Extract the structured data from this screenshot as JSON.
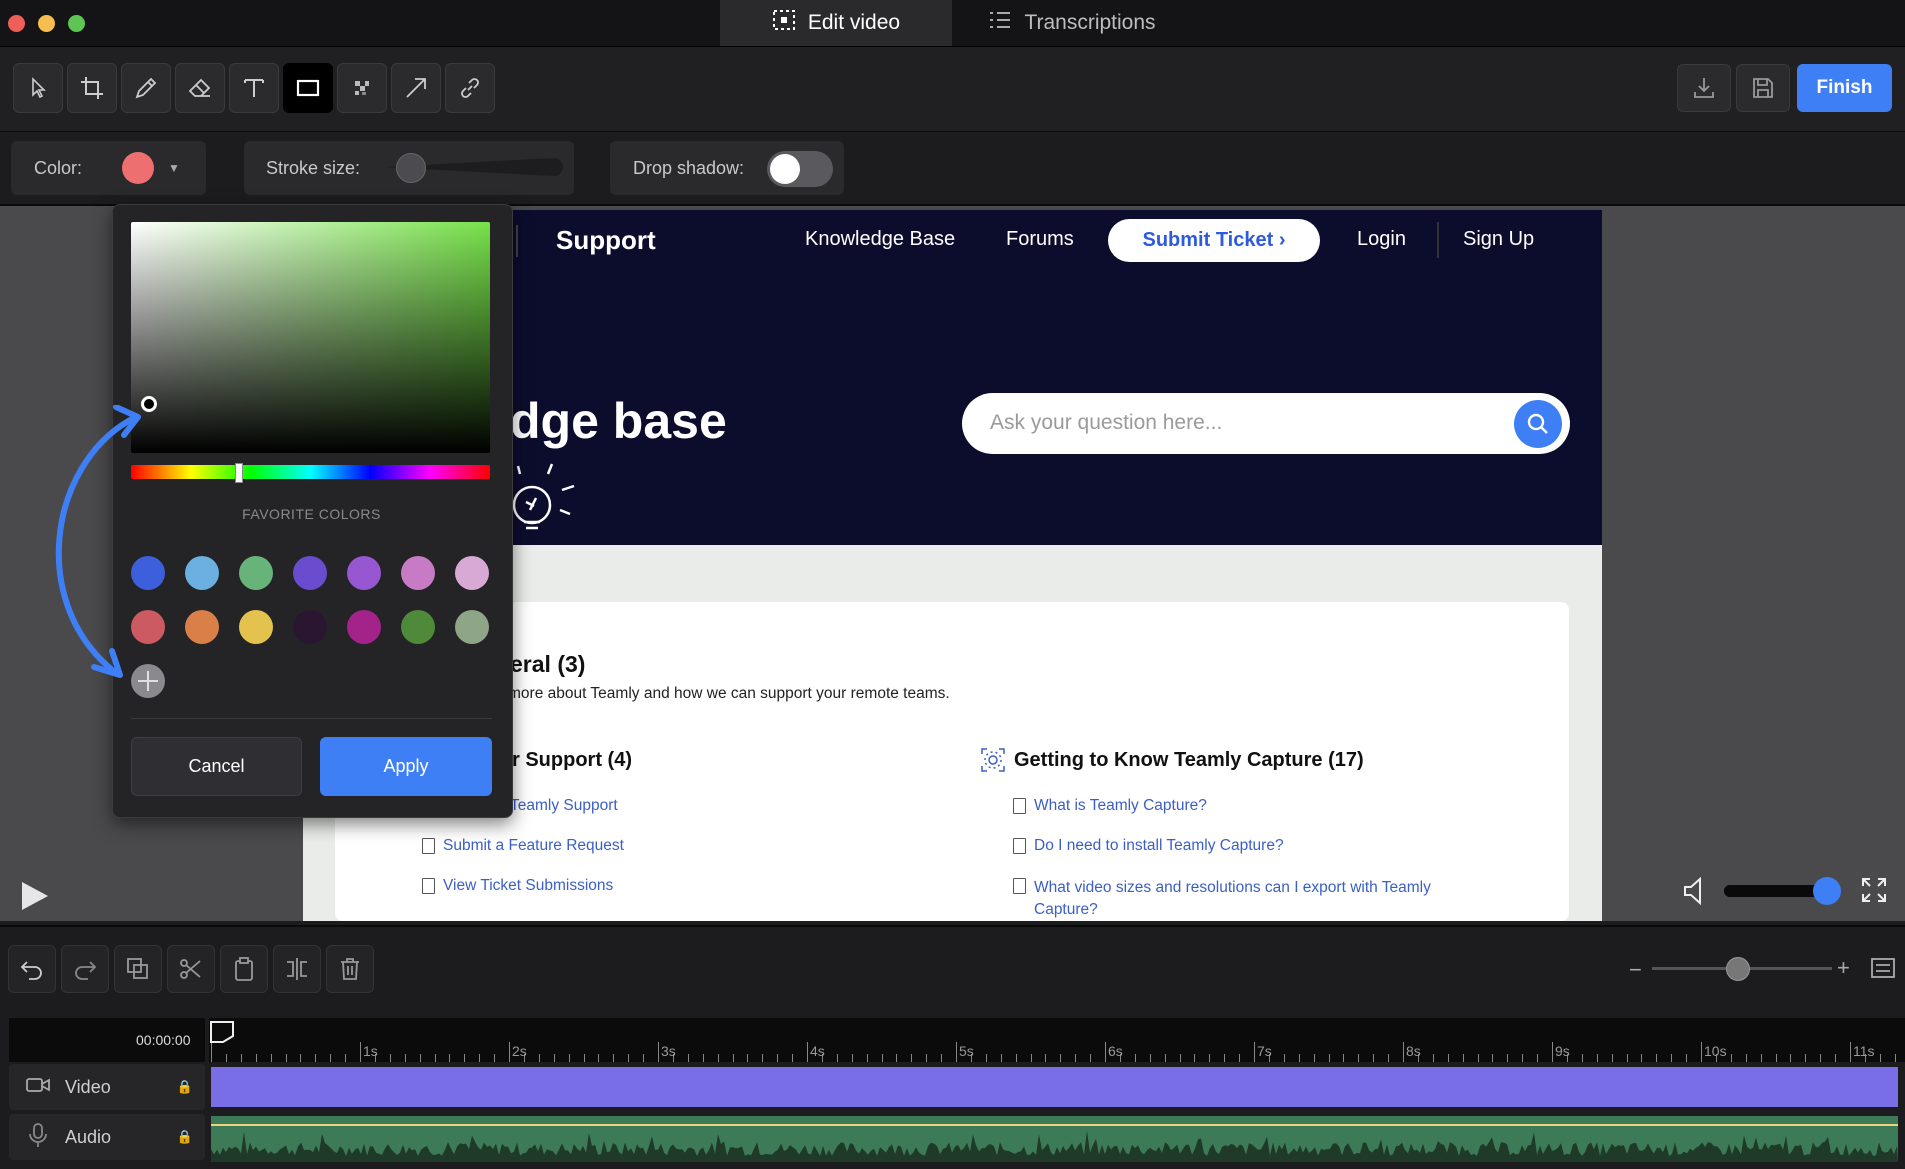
{
  "titlebar": {
    "tabs": [
      {
        "label": "Edit video",
        "icon": "dashed-select-icon",
        "active": true
      },
      {
        "label": "Transcriptions",
        "icon": "list-icon",
        "active": false
      }
    ]
  },
  "toolbar": {
    "tools": [
      "select-icon",
      "crop-icon",
      "pencil-icon",
      "eraser-icon",
      "text-icon",
      "rectangle-icon",
      "blur-icon",
      "arrow-icon",
      "link-icon"
    ],
    "selected_tool": "rectangle-icon",
    "finish_label": "Finish"
  },
  "options": {
    "color_label": "Color:",
    "color_value": "#ee6f6f",
    "stroke_label": "Stroke size:",
    "shadow_label": "Drop shadow:",
    "shadow_on": false
  },
  "picker": {
    "favorites_label": "FAVORITE COLORS",
    "favorites_row1": [
      "#3d5fdb",
      "#6bb0e0",
      "#68b37a",
      "#6a4ccf",
      "#9757d0",
      "#c77bc4",
      "#d9a9d5"
    ],
    "favorites_row2": [
      "#cc5a63",
      "#d98049",
      "#e3c24d",
      "#2b1631",
      "#a4238a",
      "#4f8a3a",
      "#8fa587"
    ],
    "cancel_label": "Cancel",
    "apply_label": "Apply"
  },
  "website": {
    "brand": "Support",
    "nav": [
      "Knowledge Base",
      "Forums",
      "Login",
      "Sign Up"
    ],
    "submit_ticket": "Submit Ticket ›",
    "hero_title": "dge base",
    "search_placeholder": "Ask your question here...",
    "general_title": "eral (3)",
    "general_desc": "more about Teamly and how we can support your remote teams.",
    "support_title": "r Support (4)",
    "support_links": [
      "Teamly Support",
      "Submit a Feature Request",
      "View Ticket Submissions"
    ],
    "capture_title": "Getting to Know Teamly Capture (17)",
    "capture_links": [
      "What is Teamly Capture?",
      "Do I need to install Teamly Capture?",
      "What video sizes and resolutions can I export with Teamly Capture?"
    ]
  },
  "player": {
    "volume": 0.85
  },
  "timeline": {
    "timecode": "00:00:00",
    "seconds_labels": [
      "1s",
      "2s",
      "3s",
      "4s",
      "5s",
      "6s",
      "7s",
      "8s",
      "9s",
      "10s",
      "11s"
    ],
    "tracks": [
      {
        "label": "Video",
        "icon": "video-camera-icon",
        "color": "#7a6ee6"
      },
      {
        "label": "Audio",
        "icon": "microphone-icon",
        "color": "#3a7a55"
      }
    ],
    "zoom": 0.62
  }
}
